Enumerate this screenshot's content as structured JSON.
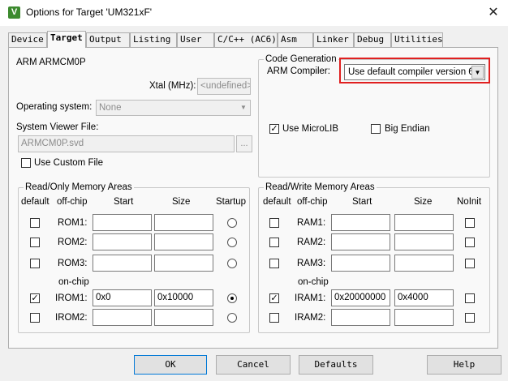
{
  "window": {
    "title": "Options for Target 'UM321xF'",
    "icon": "keil-uvision-icon",
    "close_glyph": "✕"
  },
  "tabs": [
    "Device",
    "Target",
    "Output",
    "Listing",
    "User",
    "C/C++ (AC6)",
    "Asm",
    "Linker",
    "Debug",
    "Utilities"
  ],
  "active_tab": "Target",
  "target": {
    "device": "ARM ARMCM0P",
    "xtal_label": "Xtal (MHz):",
    "xtal_value": "<undefined>",
    "os_label": "Operating system:",
    "os_value": "None",
    "svd_label": "System Viewer File:",
    "svd_value": "ARMCM0P.svd",
    "browse_label": "...",
    "custom_file_label": "Use Custom File",
    "custom_file_checked": false
  },
  "codegen": {
    "title": "Code Generation",
    "compiler_label": "ARM Compiler:",
    "compiler_value": "Use default compiler version 6",
    "microlib_label": "Use MicroLIB",
    "microlib_checked": true,
    "bigendian_label": "Big Endian",
    "bigendian_checked": false
  },
  "ro": {
    "title": "Read/Only Memory Areas",
    "headers": {
      "default": "default",
      "offchip": "off-chip",
      "start": "Start",
      "size": "Size",
      "startup": "Startup"
    },
    "onchip_label": "on-chip",
    "rows": [
      {
        "name": "ROM1:",
        "start": "",
        "size": "",
        "default": false,
        "startup": false
      },
      {
        "name": "ROM2:",
        "start": "",
        "size": "",
        "default": false,
        "startup": false
      },
      {
        "name": "ROM3:",
        "start": "",
        "size": "",
        "default": false,
        "startup": false
      },
      {
        "name": "IROM1:",
        "start": "0x0",
        "size": "0x10000",
        "default": true,
        "startup": true
      },
      {
        "name": "IROM2:",
        "start": "",
        "size": "",
        "default": false,
        "startup": false
      }
    ]
  },
  "rw": {
    "title": "Read/Write Memory Areas",
    "headers": {
      "default": "default",
      "offchip": "off-chip",
      "start": "Start",
      "size": "Size",
      "noinit": "NoInit"
    },
    "onchip_label": "on-chip",
    "rows": [
      {
        "name": "RAM1:",
        "start": "",
        "size": "",
        "default": false,
        "noinit": false
      },
      {
        "name": "RAM2:",
        "start": "",
        "size": "",
        "default": false,
        "noinit": false
      },
      {
        "name": "RAM3:",
        "start": "",
        "size": "",
        "default": false,
        "noinit": false
      },
      {
        "name": "IRAM1:",
        "start": "0x20000000",
        "size": "0x4000",
        "default": true,
        "noinit": false
      },
      {
        "name": "IRAM2:",
        "start": "",
        "size": "",
        "default": false,
        "noinit": false
      }
    ]
  },
  "buttons": {
    "ok": "OK",
    "cancel": "Cancel",
    "defaults": "Defaults",
    "help": "Help"
  },
  "colors": {
    "highlight": "#e02020",
    "app_icon": "#3c8a2e"
  }
}
